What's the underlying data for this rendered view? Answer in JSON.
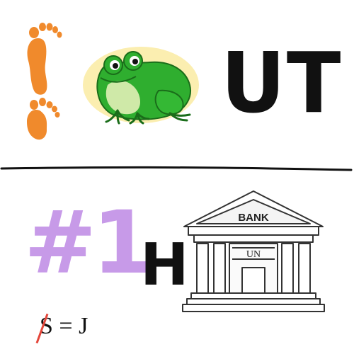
{
  "rebus": {
    "top_text": "UT",
    "bottom_letter": "H",
    "number_label": "#1",
    "strike_letter": "S",
    "equals_rule": "= J",
    "bank_sign": "BANK",
    "bank_inner": "UN"
  },
  "icons": {
    "feet": "footprints-icon",
    "frog": "frog-icon",
    "bank": "bank-building-icon"
  },
  "colors": {
    "feet": "#f08a2c",
    "frog_green": "#2fae2f",
    "frog_bg": "#fbeeb0",
    "purple": "#c79ae8",
    "strike_red": "#e4463a",
    "ink": "#111111"
  }
}
